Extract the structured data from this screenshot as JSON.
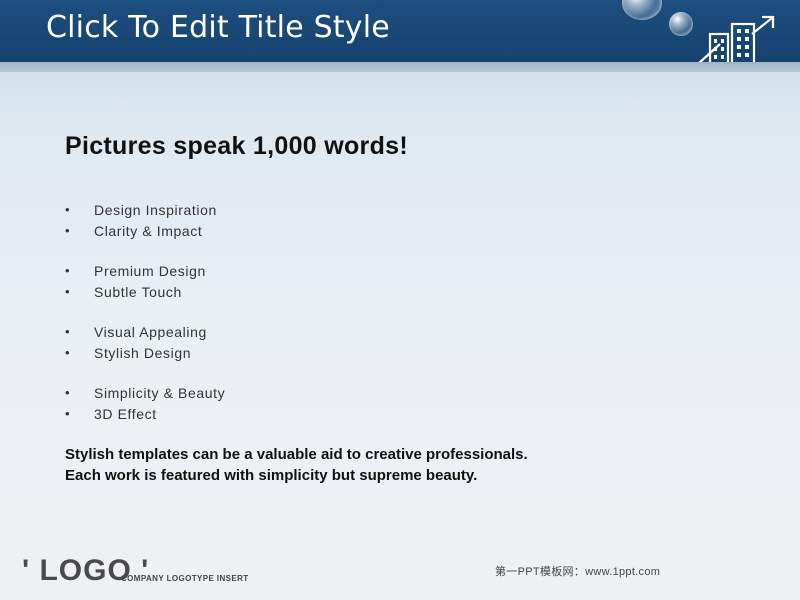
{
  "slide": {
    "title": "Click To Edit Title Style",
    "headline": "Pictures speak 1,000 words!",
    "bullet_groups": [
      [
        "Design Inspiration",
        "Clarity & Impact"
      ],
      [
        "Premium Design",
        "Subtle Touch"
      ],
      [
        "Visual Appealing",
        "Stylish Design"
      ],
      [
        "Simplicity & Beauty",
        "3D Effect"
      ]
    ],
    "summary": [
      "Stylish templates can be a valuable aid to creative professionals.",
      "Each work is featured with simplicity but supreme beauty."
    ],
    "logo": "' LOGO '",
    "logo_caption": "COMPANY LOGOTYPE INSERT",
    "footer_text": "第一PPT模板网：www.1ppt.com"
  },
  "icons": {
    "header_decoration": "buildings-arrow-icon",
    "bubbles": "bubble-icon"
  },
  "colors": {
    "header": "#1d4e80",
    "stripe": "#b9c8d6",
    "text": "#111111"
  }
}
